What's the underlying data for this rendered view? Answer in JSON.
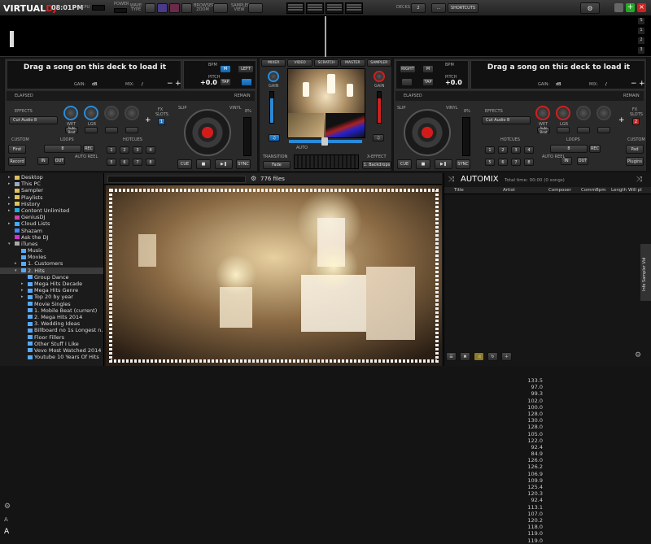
{
  "app": {
    "logo_a": "VIRTUAL",
    "logo_b": "DJ",
    "clock": "08:01PM",
    "cpu": "CPU",
    "power": "POWER",
    "wave_type": "WAVE TYPE",
    "browser_zoom": "BROWSER ZOOM",
    "sampler_view": "SAMPLER VIEW",
    "decks": "DECKS",
    "decks_value": "2",
    "dots": "...",
    "shortcut": "SHORTCUTS"
  },
  "left_deck": {
    "drag": "Drag a song on this deck to load it",
    "gain": "GAIN:",
    "gain_val": "dB",
    "mix": "MIX:",
    "mix_val": "/",
    "bpm": "BPM",
    "pitch": "PITCH",
    "pitch_val": "+0.0",
    "tap": "TAP",
    "left": "LEFT",
    "m": "M",
    "elapsed": "ELAPSED",
    "remain": "REMAIN",
    "effects": "EFFECTS",
    "effect_name": "Cut Audio 8",
    "wet": "WET",
    "lgr": "LGR",
    "autobeat": "Auto Beat",
    "fx_slots": "FX SLOTS",
    "fx_num": "1",
    "custom": "CUSTOM",
    "first": "First",
    "record": "Record",
    "loops": "LOOPS",
    "loop_val": "8",
    "rec": "REC",
    "in": "IN",
    "out": "OUT",
    "autoreel": "AUTO REEL",
    "hotcues": "HOTCUES",
    "cue": "CUE",
    "sync": "SYNC",
    "slip": "SLIP",
    "vinyl": "VINYL",
    "pct": "8%"
  },
  "right_deck": {
    "drag": "Drag a song on this deck to load it",
    "gain": "GAIN:",
    "gain_val": "dB",
    "mix": "MIX:",
    "mix_val": "/",
    "bpm": "BPM",
    "pitch": "PITCH",
    "pitch_val": "+0.0",
    "tap": "TAP",
    "right": "RIGHT",
    "m": "M",
    "elapsed": "ELAPSED",
    "remain": "REMAIN",
    "effects": "EFFECTS",
    "effect_name": "Cut Audio 8",
    "wet": "WET",
    "lgr": "LGR",
    "autobeat": "Auto Beat",
    "fx_slots": "FX SLOTS",
    "fx_num": "2",
    "custom": "CUSTOM",
    "pad": "Pad",
    "plugins": "Plugins",
    "loops": "LOOPS",
    "loop_val": "8",
    "rec": "REC",
    "in": "IN",
    "out": "OUT",
    "autoreel": "AUTO REEL",
    "hotcues": "HOTCUES",
    "cue": "CUE",
    "sync": "SYNC",
    "slip": "SLIP",
    "vinyl": "VINYL",
    "pct": "8%"
  },
  "mixer": {
    "tabs": [
      "MIXER",
      "VIDEO",
      "SCRATCH",
      "MASTER",
      "SAMPLER"
    ],
    "gain": "GAIN",
    "transition": "TRANSITION",
    "fade": "Fade",
    "xeffect": "X-EFFECT",
    "backdrops": "1. Backdrops",
    "auto": "AUTO"
  },
  "folders": [
    {
      "label": "Desktop",
      "indent": 0,
      "color": "#e0c060",
      "arrow": "▸"
    },
    {
      "label": "This PC",
      "indent": 0,
      "color": "#9ab",
      "arrow": "▸"
    },
    {
      "label": "Sampler",
      "indent": 0,
      "color": "#e0c060",
      "arrow": ""
    },
    {
      "label": "Playlists",
      "indent": 0,
      "color": "#e0c060",
      "arrow": "▸"
    },
    {
      "label": "History",
      "indent": 0,
      "color": "#e0c060",
      "arrow": "▸"
    },
    {
      "label": "Content Unlimited",
      "indent": 0,
      "color": "#2ad",
      "arrow": "▸"
    },
    {
      "label": "GeniusDJ",
      "indent": 0,
      "color": "#c4a",
      "arrow": ""
    },
    {
      "label": "Cloud Lists",
      "indent": 0,
      "color": "#4af",
      "arrow": "▸"
    },
    {
      "label": "Shazam",
      "indent": 0,
      "color": "#48f",
      "arrow": ""
    },
    {
      "label": "Ask the DJ",
      "indent": 0,
      "color": "#c3c",
      "arrow": ""
    },
    {
      "label": "iTunes",
      "indent": 0,
      "color": "#aaa",
      "arrow": "▾"
    },
    {
      "label": "Music",
      "indent": 1,
      "color": "#5af",
      "arrow": ""
    },
    {
      "label": "Movies",
      "indent": 1,
      "color": "#5af",
      "arrow": ""
    },
    {
      "label": "1. Customers",
      "indent": 1,
      "color": "#5af",
      "arrow": "▸"
    },
    {
      "label": "2. Hits",
      "indent": 1,
      "color": "#5af",
      "arrow": "▾",
      "selected": true
    },
    {
      "label": "Group Dance",
      "indent": 2,
      "color": "#5af",
      "arrow": ""
    },
    {
      "label": "Mega Hits Decade",
      "indent": 2,
      "color": "#5af",
      "arrow": "▸"
    },
    {
      "label": "Mega Hits Genre",
      "indent": 2,
      "color": "#5af",
      "arrow": "▸"
    },
    {
      "label": "Top 20 by year",
      "indent": 2,
      "color": "#5af",
      "arrow": "▸"
    },
    {
      "label": "Movie Singles",
      "indent": 2,
      "color": "#5af",
      "arrow": ""
    },
    {
      "label": "1. Mobile Beat (current)",
      "indent": 2,
      "color": "#5af",
      "arrow": ""
    },
    {
      "label": "2. Mega Hits 2014",
      "indent": 2,
      "color": "#5af",
      "arrow": ""
    },
    {
      "label": "3. Wedding Ideas",
      "indent": 2,
      "color": "#5af",
      "arrow": ""
    },
    {
      "label": "Billboard no 1s Longest n.",
      "indent": 2,
      "color": "#5af",
      "arrow": ""
    },
    {
      "label": "Floor Fillers",
      "indent": 2,
      "color": "#5af",
      "arrow": ""
    },
    {
      "label": "Other Stuff I Like",
      "indent": 2,
      "color": "#5af",
      "arrow": ""
    },
    {
      "label": "Vevo Most Watched 2014",
      "indent": 2,
      "color": "#5af",
      "arrow": ""
    },
    {
      "label": "Youtube 10 Years Of Hits",
      "indent": 2,
      "color": "#5af",
      "arrow": ""
    }
  ],
  "filelist": {
    "count": "776 files",
    "bpms": [
      "133.5",
      "97.0",
      "99.3",
      "102.0",
      "100.0",
      "128.0",
      "130.0",
      "128.0",
      "105.0",
      "122.0",
      "92.4",
      "84.9",
      "126.0",
      "126.2",
      "106.9",
      "109.9",
      "125.4",
      "120.3",
      "92.4",
      "113.1",
      "107.0",
      "120.2",
      "118.0",
      "119.0",
      "119.0"
    ]
  },
  "automix": {
    "title": "AUTOMIX",
    "total": "Total time: 00:00 (0 songs)",
    "cols": [
      "Title",
      "Artist",
      "Composer",
      "Comm",
      "Bpm",
      "Length",
      "Will pl"
    ]
  },
  "side_info": {
    "label": "Info Sampler Vid"
  }
}
